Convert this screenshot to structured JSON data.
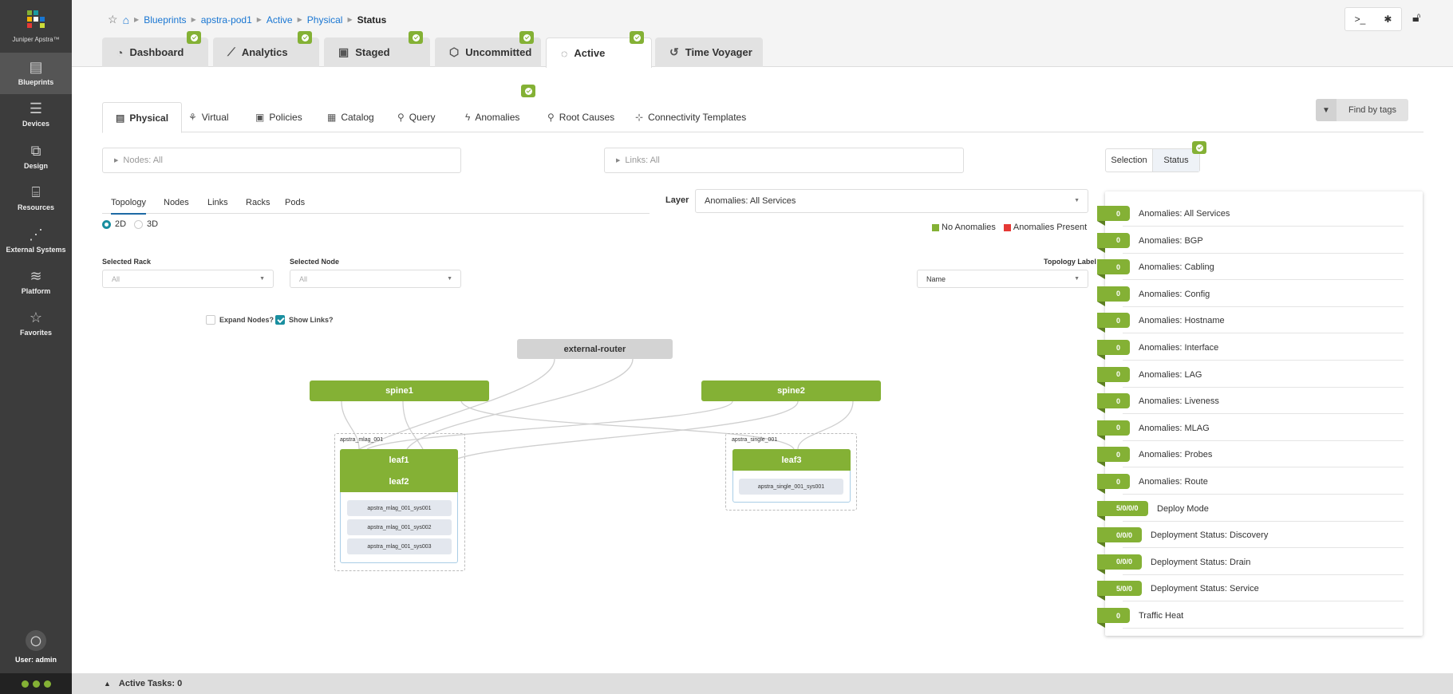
{
  "app": {
    "name": "Juniper Apstra™"
  },
  "sidebar": {
    "items": [
      {
        "label": "Blueprints",
        "icon": "blueprints-icon",
        "glyph": "▤",
        "active": true
      },
      {
        "label": "Devices",
        "icon": "devices-icon",
        "glyph": "☰"
      },
      {
        "label": "Design",
        "icon": "design-icon",
        "glyph": "⧉"
      },
      {
        "label": "Resources",
        "icon": "resources-icon",
        "glyph": "⌸"
      },
      {
        "label": "External Systems",
        "icon": "external-systems-icon",
        "glyph": "⋰"
      },
      {
        "label": "Platform",
        "icon": "platform-icon",
        "glyph": "≋"
      },
      {
        "label": "Favorites",
        "icon": "star-icon",
        "glyph": "☆"
      }
    ],
    "user": "User: admin"
  },
  "breadcrumb": {
    "items": [
      "Blueprints",
      "apstra-pod1",
      "Active",
      "Physical"
    ],
    "current": "Status"
  },
  "main_tabs": [
    {
      "label": "Dashboard",
      "glyph": "◔",
      "badge": true
    },
    {
      "label": "Analytics",
      "glyph": "⟋",
      "badge": true
    },
    {
      "label": "Staged",
      "glyph": "▣",
      "badge": true
    },
    {
      "label": "Uncommitted",
      "glyph": "⬡",
      "badge": true
    },
    {
      "label": "Active",
      "glyph": "◌",
      "badge": true,
      "active": true
    },
    {
      "label": "Time Voyager",
      "glyph": "↺",
      "badge": false
    }
  ],
  "sub_tabs": [
    {
      "label": "Physical",
      "glyph": "▤",
      "active": true
    },
    {
      "label": "Virtual",
      "glyph": "⚘"
    },
    {
      "label": "Policies",
      "glyph": "▣"
    },
    {
      "label": "Catalog",
      "glyph": "▦"
    },
    {
      "label": "Query",
      "glyph": "⚲"
    },
    {
      "label": "Anomalies",
      "glyph": "ϟ",
      "badge": true
    },
    {
      "label": "Root Causes",
      "glyph": "⚲"
    },
    {
      "label": "Connectivity Templates",
      "glyph": "⊹"
    }
  ],
  "find_by_tags": "Find by tags",
  "filters": {
    "nodes": "Nodes: All",
    "links": "Links: All"
  },
  "panel_tabs": {
    "selection": "Selection",
    "status": "Status"
  },
  "topology_tabs": [
    "Topology",
    "Nodes",
    "Links",
    "Racks",
    "Pods"
  ],
  "view_mode": {
    "options": [
      "2D",
      "3D"
    ],
    "selected": "2D"
  },
  "layer": {
    "label": "Layer",
    "value": "Anomalies: All Services"
  },
  "legend": {
    "items": [
      {
        "label": "No Anomalies",
        "color": "#84b135"
      },
      {
        "label": "Anomalies Present",
        "color": "#e53935"
      }
    ]
  },
  "selected_rack": {
    "label": "Selected Rack",
    "placeholder": "All"
  },
  "selected_node": {
    "label": "Selected Node",
    "placeholder": "All"
  },
  "topology_label": {
    "label": "Topology Label",
    "value": "Name"
  },
  "checkboxes": {
    "expand_nodes": {
      "label": "Expand Nodes?",
      "checked": false
    },
    "show_links": {
      "label": "Show Links?",
      "checked": true
    }
  },
  "topology": {
    "external_router": "external-router",
    "spines": [
      "spine1",
      "spine2"
    ],
    "racks": [
      {
        "name": "apstra_mlag_001",
        "leafs": [
          "leaf1",
          "leaf2"
        ],
        "systems": [
          "apstra_mlag_001_sys001",
          "apstra_mlag_001_sys002",
          "apstra_mlag_001_sys003"
        ]
      },
      {
        "name": "apstra_single_001",
        "leafs": [
          "leaf3"
        ],
        "systems": [
          "apstra_single_001_sys001"
        ]
      }
    ]
  },
  "status": {
    "rows": [
      {
        "value": "0",
        "label": "Anomalies: All Services"
      },
      {
        "value": "0",
        "label": "Anomalies: BGP"
      },
      {
        "value": "0",
        "label": "Anomalies: Cabling"
      },
      {
        "value": "0",
        "label": "Anomalies: Config"
      },
      {
        "value": "0",
        "label": "Anomalies: Hostname"
      },
      {
        "value": "0",
        "label": "Anomalies: Interface"
      },
      {
        "value": "0",
        "label": "Anomalies: LAG"
      },
      {
        "value": "0",
        "label": "Anomalies: Liveness"
      },
      {
        "value": "0",
        "label": "Anomalies: MLAG"
      },
      {
        "value": "0",
        "label": "Anomalies: Probes"
      },
      {
        "value": "0",
        "label": "Anomalies: Route"
      },
      {
        "value": "5/0/0/0",
        "label": "Deploy Mode"
      },
      {
        "value": "0/0/0",
        "label": "Deployment Status: Discovery"
      },
      {
        "value": "0/0/0",
        "label": "Deployment Status: Drain"
      },
      {
        "value": "5/0/0",
        "label": "Deployment Status: Service"
      },
      {
        "value": "0",
        "label": "Traffic Heat"
      }
    ]
  },
  "bottom": {
    "active_tasks": "Active Tasks: 0"
  }
}
